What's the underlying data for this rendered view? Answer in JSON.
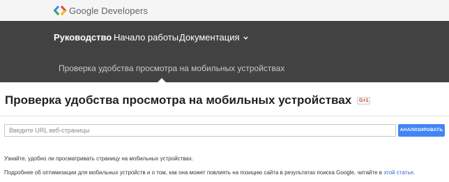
{
  "header": {
    "logo_text": "Google Developers",
    "logo_icon": "google-developers-chevron-logo",
    "brand_colors": [
      "#4285f4",
      "#ea4335",
      "#fbbc05",
      "#34a853"
    ]
  },
  "nav": {
    "tabs": [
      {
        "label": "Руководство",
        "active": true
      },
      {
        "label": "Начало работы",
        "active": false
      },
      {
        "label": "Документация",
        "active": false,
        "has_dropdown": true,
        "icon": "chevron-down-icon"
      }
    ],
    "subtitle": "Проверка удобства просмотра на мобильных устройствах"
  },
  "main": {
    "title": "Проверка удобства просмотра на мобильных устройствах",
    "gplus_label": "G+1",
    "search": {
      "placeholder": "Введите URL веб-страницы",
      "value": ""
    },
    "analyze_label": "АНАЛИЗИРОВАТЬ",
    "accent_color": "#4285f4",
    "description_1": "Узнайте, удобно ли просматривать страницу на мобильных устройствах.",
    "description_2": "Подробнее об оптимизации для мобильных устройств и о том, как она может повлиять на позицию сайта в результатах поиска Google, читайте в ",
    "description_2_link": "этой статье",
    "description_2_end": "."
  }
}
